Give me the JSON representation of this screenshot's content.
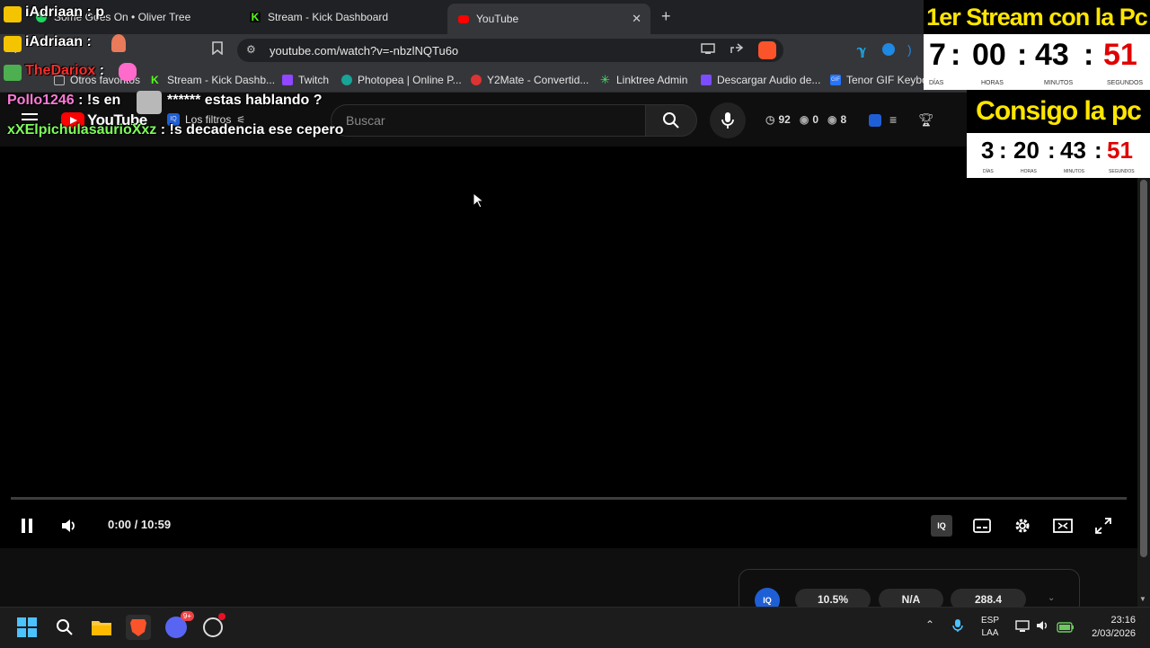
{
  "browser": {
    "tabs": [
      {
        "label": "Some Goes On • Oliver Tree"
      },
      {
        "label": "Stream - Kick Dashboard"
      },
      {
        "label": "YouTube"
      }
    ],
    "new_tab": "+",
    "close_tab": "✕",
    "url": "youtube.com/watch?v=-nbzlNQTu6o",
    "bookmarks": [
      "Otros favoritos",
      "Stream - Kick Dashb...",
      "Twitch",
      "Photopea | Online P...",
      "Y2Mate - Convertid...",
      "Linktree Admin",
      "Descargar Audio de...",
      "Tenor GIF Keyboa"
    ]
  },
  "youtube": {
    "logo_text": "YouTube",
    "filters_label": "Los filtros",
    "search_placeholder": "Buscar",
    "ext_stats": {
      "a": "92",
      "b": "0",
      "c": "8"
    }
  },
  "player": {
    "time": "0:00 / 10:59",
    "progress_fraction": 0.0
  },
  "stats_bar": {
    "values": [
      "10.5%",
      "N/A",
      "288.4"
    ]
  },
  "chat": [
    {
      "user": "iAdriaan",
      "message": ": p",
      "color": "#ffffff"
    },
    {
      "user": "iAdriaan",
      "message": ":",
      "color": "#ffffff"
    },
    {
      "user": "TheDariox",
      "message": ":",
      "color": "#ff2d2d"
    },
    {
      "user": "Pollo1246",
      "message": ": !s en",
      "color": "#ff7ad9"
    },
    {
      "user": "",
      "message": "****** estas hablando ?",
      "color": "#ffffff"
    },
    {
      "user": "xXElpichulasaurioXxz",
      "message": ": !s decadencia ese cepero",
      "color": "#7dff5a"
    }
  ],
  "countdown1": {
    "title": "1er Stream con la Pc",
    "days": "7",
    "hours": "00",
    "minutes": "43",
    "seconds": "51",
    "labels": [
      "DÍAS",
      "HORAS",
      "MINUTOS",
      "SEGUNDOS"
    ]
  },
  "countdown2": {
    "title": "Consigo la pc",
    "days": "3",
    "hours": "20",
    "minutes": "43",
    "seconds": "51",
    "labels": [
      "DÍAS",
      "HORAS",
      "MINUTOS",
      "SEGUNDOS"
    ]
  },
  "taskbar": {
    "discord_badge": "9+",
    "lang_line1": "ESP",
    "lang_line2": "LAA",
    "time": "23:16",
    "date": "2/03/2026"
  },
  "colors": {
    "youtube_red": "#ff0000",
    "countdown_yellow": "#ffe600",
    "seconds_red": "#e00000",
    "kick_green": "#53fc18"
  }
}
